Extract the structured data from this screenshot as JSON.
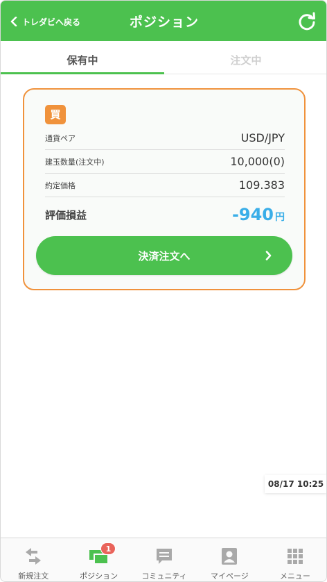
{
  "header": {
    "back_label": "トレダビへ戻る",
    "title": "ポジション",
    "bg_color": "#4cc14f"
  },
  "tabs": [
    {
      "label": "保有中",
      "active": true
    },
    {
      "label": "注文中",
      "active": false
    }
  ],
  "position": {
    "side_badge": "買",
    "rows": [
      {
        "label": "通貨ペア",
        "value": "USD/JPY"
      },
      {
        "label": "建玉数量(注文中)",
        "value": "10,000(0)"
      },
      {
        "label": "約定価格",
        "value": "109.383"
      }
    ],
    "pnl_label": "評価損益",
    "pnl_value": "-940",
    "pnl_unit": "円",
    "settle_button": "決済注文へ"
  },
  "timestamp": "08/17 10:25",
  "bottom_nav": [
    {
      "label": "新規注文",
      "icon": "swap-arrows-icon"
    },
    {
      "label": "ポジション",
      "icon": "positions-icon",
      "badge": "1"
    },
    {
      "label": "コミュニティ",
      "icon": "chat-bubble-icon"
    },
    {
      "label": "マイページ",
      "icon": "profile-icon"
    },
    {
      "label": "メニュー",
      "icon": "grid-menu-icon"
    }
  ],
  "colors": {
    "accent_green": "#4cc14f",
    "card_border": "#f0923c",
    "pnl_blue": "#3aaee8",
    "badge_red": "#e9635a"
  }
}
